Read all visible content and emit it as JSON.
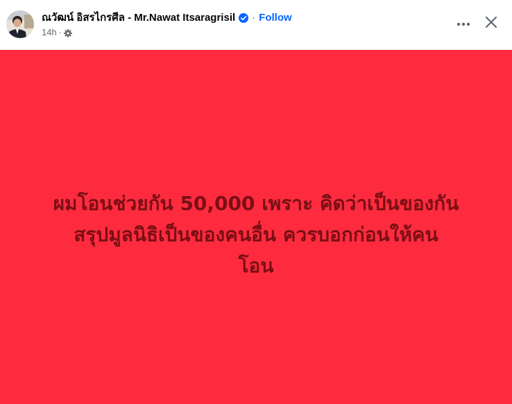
{
  "header": {
    "author_name": "ณวัฒน์ อิสรไกรศีล - Mr.Nawat Itsaragrisil",
    "separator": "·",
    "follow_label": "Follow",
    "timestamp": "14h",
    "meta_separator": "·",
    "verified": true,
    "audience_icon": "gear-icon",
    "more_icon": "more-options-icon",
    "close_icon": "close-icon"
  },
  "post": {
    "background_color": "#fe2b3e",
    "text_color": "#7a0f15",
    "text_lines": [
      "ผมโอนช่วยกัน 50,000 เพราะ คิดว่าเป็นของกัน",
      "สรุปมูลนิธิเป็นของคนอื่น ควรบอกก่อนให้คน",
      "โอน"
    ]
  },
  "colors": {
    "link": "#0866ff",
    "verified_badge": "#0866ff",
    "secondary_text": "#65676b",
    "primary_text": "#050505"
  }
}
